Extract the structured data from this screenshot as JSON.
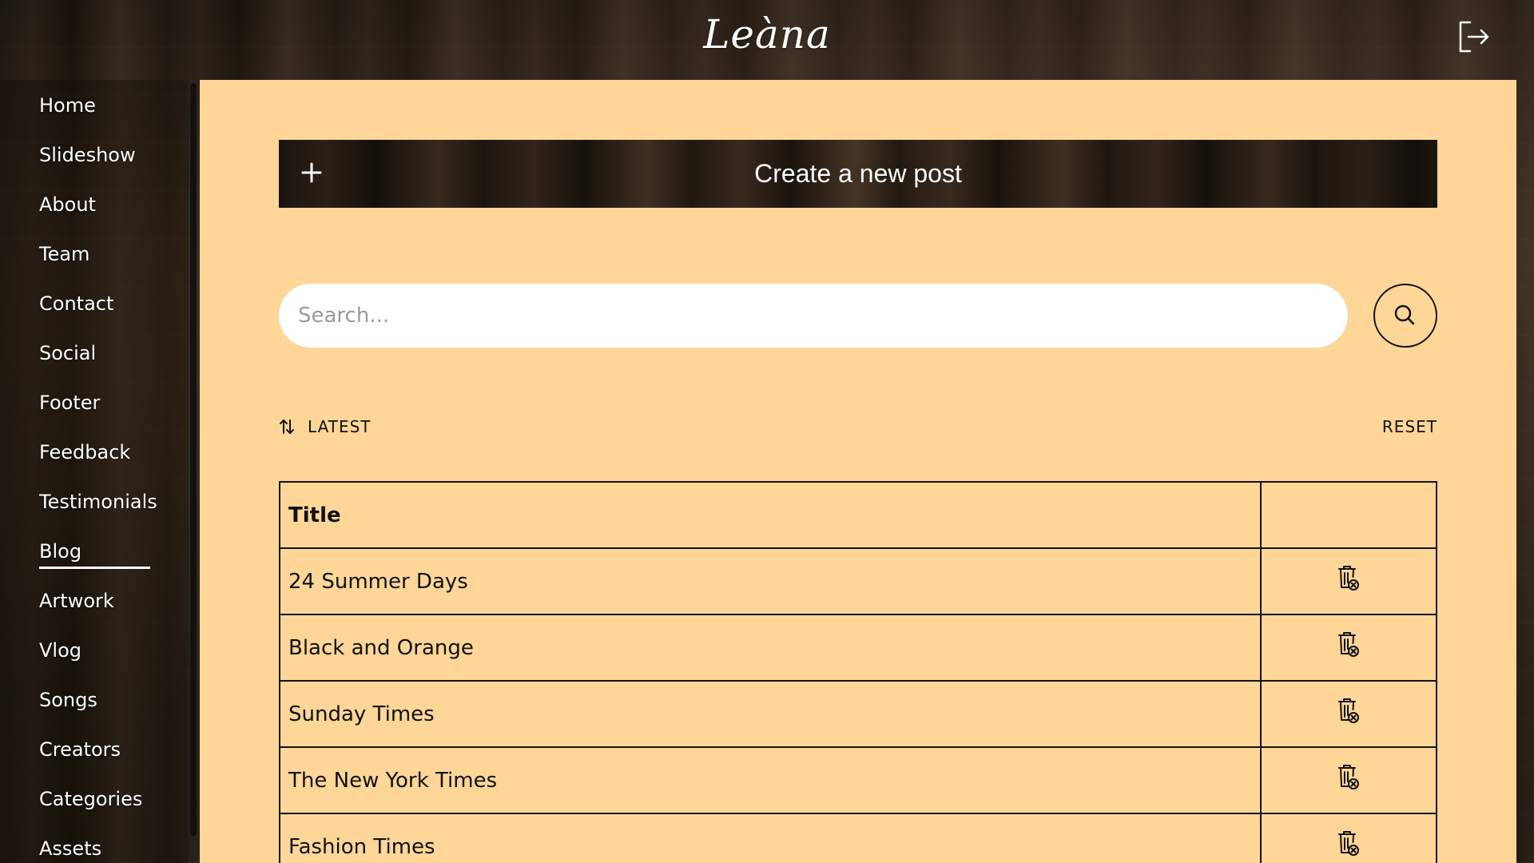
{
  "app": {
    "logo_text": "Leàna"
  },
  "sidebar": {
    "items": [
      {
        "label": "Home"
      },
      {
        "label": "Slideshow"
      },
      {
        "label": "About"
      },
      {
        "label": "Team"
      },
      {
        "label": "Contact"
      },
      {
        "label": "Social"
      },
      {
        "label": "Footer"
      },
      {
        "label": "Feedback"
      },
      {
        "label": "Testimonials"
      },
      {
        "label": "Blog",
        "active": true
      },
      {
        "label": "Artwork"
      },
      {
        "label": "Vlog"
      },
      {
        "label": "Songs"
      },
      {
        "label": "Creators"
      },
      {
        "label": "Categories"
      },
      {
        "label": "Assets"
      }
    ]
  },
  "main": {
    "create_label": "Create a new post",
    "search": {
      "placeholder": "Search...",
      "value": ""
    },
    "sort_label": "LATEST",
    "reset_label": "RESET",
    "table": {
      "columns": [
        "Title",
        ""
      ],
      "rows": [
        {
          "title": "24 Summer Days"
        },
        {
          "title": "Black and Orange"
        },
        {
          "title": "Sunday Times"
        },
        {
          "title": "The New York Times"
        },
        {
          "title": "Fashion Times"
        }
      ]
    }
  },
  "colors": {
    "panel_bg": "#fed697",
    "text": "#111111",
    "nav_text": "#ffffff"
  },
  "icons": {
    "logout": "logout-icon",
    "plus": "plus-icon",
    "search": "search-icon",
    "sort": "sort-arrows-icon",
    "delete": "trash-delete-icon"
  }
}
